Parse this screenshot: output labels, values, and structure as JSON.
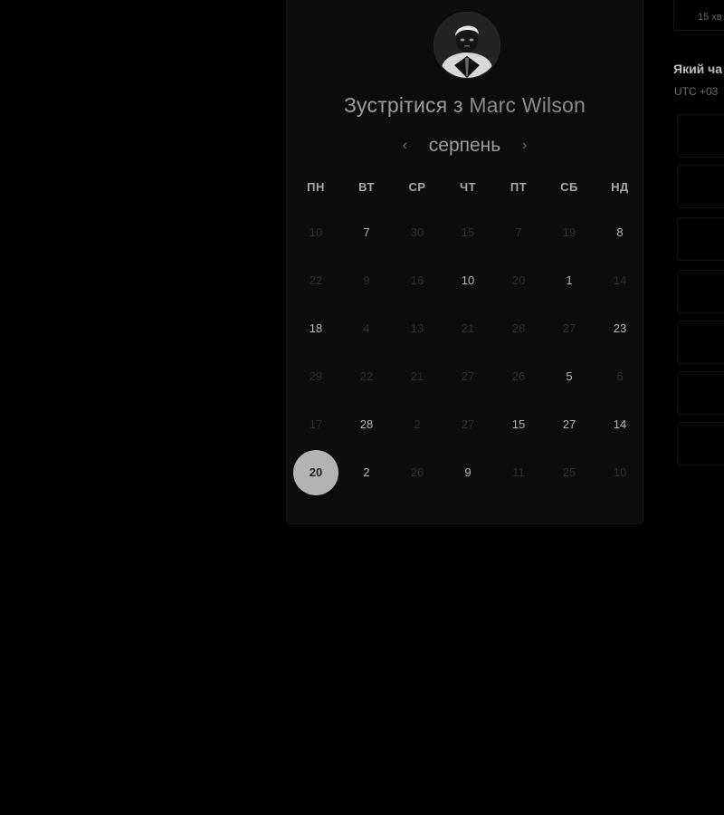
{
  "scheduler": {
    "title_prefix": "Зустрітися з",
    "host_name": "Marc Wilson",
    "month": "серпень",
    "prev_icon": "chevron-left-icon",
    "next_icon": "chevron-right-icon",
    "weekdays": [
      "ПН",
      "ВТ",
      "СР",
      "ЧТ",
      "ПТ",
      "СБ",
      "НД"
    ],
    "days": [
      [
        {
          "n": "10",
          "s": "muted"
        },
        {
          "n": "7",
          "s": "active"
        },
        {
          "n": "30",
          "s": "muted"
        },
        {
          "n": "15",
          "s": "muted"
        },
        {
          "n": "7",
          "s": "muted"
        },
        {
          "n": "19",
          "s": "muted"
        },
        {
          "n": "8",
          "s": "active"
        }
      ],
      [
        {
          "n": "22",
          "s": "muted"
        },
        {
          "n": "9",
          "s": "muted"
        },
        {
          "n": "16",
          "s": "muted"
        },
        {
          "n": "10",
          "s": "active"
        },
        {
          "n": "20",
          "s": "muted"
        },
        {
          "n": "1",
          "s": "active"
        },
        {
          "n": "14",
          "s": "muted"
        }
      ],
      [
        {
          "n": "18",
          "s": "active"
        },
        {
          "n": "4",
          "s": "muted"
        },
        {
          "n": "13",
          "s": "muted"
        },
        {
          "n": "21",
          "s": "muted"
        },
        {
          "n": "28",
          "s": "muted"
        },
        {
          "n": "27",
          "s": "muted"
        },
        {
          "n": "23",
          "s": "active"
        }
      ],
      [
        {
          "n": "29",
          "s": "muted"
        },
        {
          "n": "22",
          "s": "muted"
        },
        {
          "n": "21",
          "s": "muted"
        },
        {
          "n": "27",
          "s": "muted"
        },
        {
          "n": "26",
          "s": "muted"
        },
        {
          "n": "5",
          "s": "active"
        },
        {
          "n": "6",
          "s": "muted"
        }
      ],
      [
        {
          "n": "17",
          "s": "muted"
        },
        {
          "n": "28",
          "s": "active"
        },
        {
          "n": "2",
          "s": "muted"
        },
        {
          "n": "27",
          "s": "muted"
        },
        {
          "n": "15",
          "s": "active"
        },
        {
          "n": "27",
          "s": "active"
        },
        {
          "n": "14",
          "s": "active"
        }
      ],
      [
        {
          "n": "20",
          "s": "selected"
        },
        {
          "n": "2",
          "s": "active"
        },
        {
          "n": "26",
          "s": "muted"
        },
        {
          "n": "9",
          "s": "active"
        },
        {
          "n": "11",
          "s": "muted"
        },
        {
          "n": "25",
          "s": "muted"
        },
        {
          "n": "10",
          "s": "muted"
        }
      ]
    ]
  },
  "side_panel": {
    "duration": "15 хв",
    "question": "Який ча",
    "timezone": "UTC +03"
  },
  "colors": {
    "background": "#000000",
    "card": "#0c0c0c",
    "selected_day": "#b3b3b3",
    "active_text": "#b8b8b8",
    "muted_text": "#2e2e2e"
  }
}
